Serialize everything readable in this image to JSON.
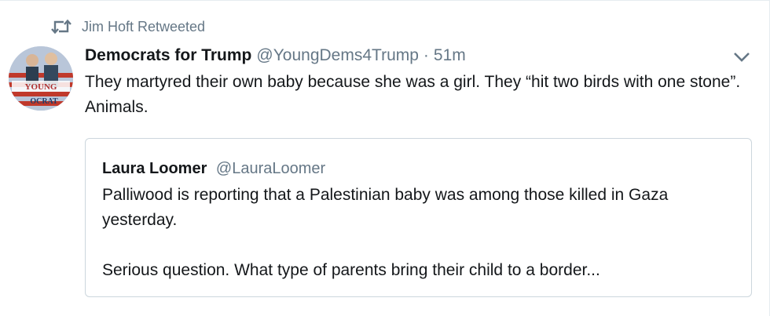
{
  "retweet": {
    "icon": "retweet-icon",
    "text": "Jim Hoft Retweeted"
  },
  "tweet": {
    "fullname": "Democrats for Trump",
    "username": "@YoungDems4Trump",
    "separator": "·",
    "time": "51m",
    "text": "They martyred their own baby because she was a girl. They “hit two birds with one stone”. Animals.",
    "avatar_text_top": "YOUNG",
    "avatar_text_bottom": "OCRAT",
    "caret_icon": "chevron-down-icon"
  },
  "quoted_tweet": {
    "fullname": "Laura Loomer",
    "username": "@LauraLoomer",
    "paragraph_1": "Palliwood is reporting that a Palestinian baby was among those killed in Gaza yesterday.",
    "paragraph_2": "Serious question. What type of parents bring their child to a border..."
  },
  "colors": {
    "text": "#14171a",
    "secondary": "#657786",
    "border": "#ccd6dd"
  }
}
